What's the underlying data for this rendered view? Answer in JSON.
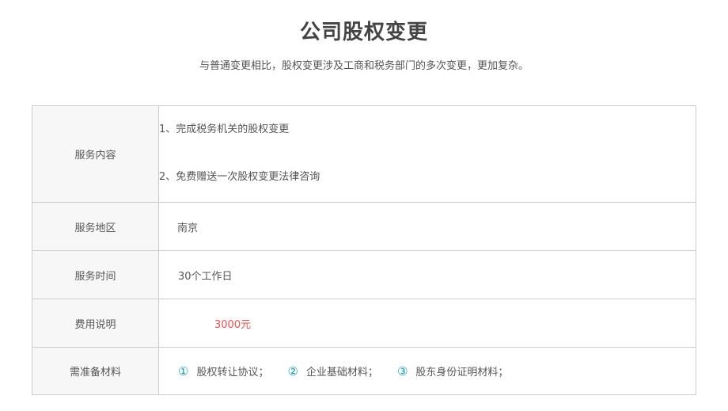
{
  "header": {
    "title": "公司股权变更",
    "subtitle": "与普通变更相比，股权变更涉及工商和税务部门的多次变更，更加复杂。"
  },
  "table": {
    "content": {
      "label": "服务内容",
      "lines": [
        "1、完成税务机关的股权变更",
        "2、免费赠送一次股权变更法律咨询"
      ]
    },
    "region": {
      "label": "服务地区",
      "value": "南京"
    },
    "time": {
      "label": "服务时间",
      "value": "30个工作日"
    },
    "fee": {
      "label": "费用说明",
      "value": "3000元",
      "color": "#e8534f"
    },
    "materials": {
      "label": "需准备材料",
      "number_color": "#1a9bb8",
      "items": [
        {
          "num": "①",
          "text": "股权转让协议；"
        },
        {
          "num": "②",
          "text": "企业基础材料；"
        },
        {
          "num": "③",
          "text": "股东身份证明材料；"
        }
      ]
    }
  }
}
